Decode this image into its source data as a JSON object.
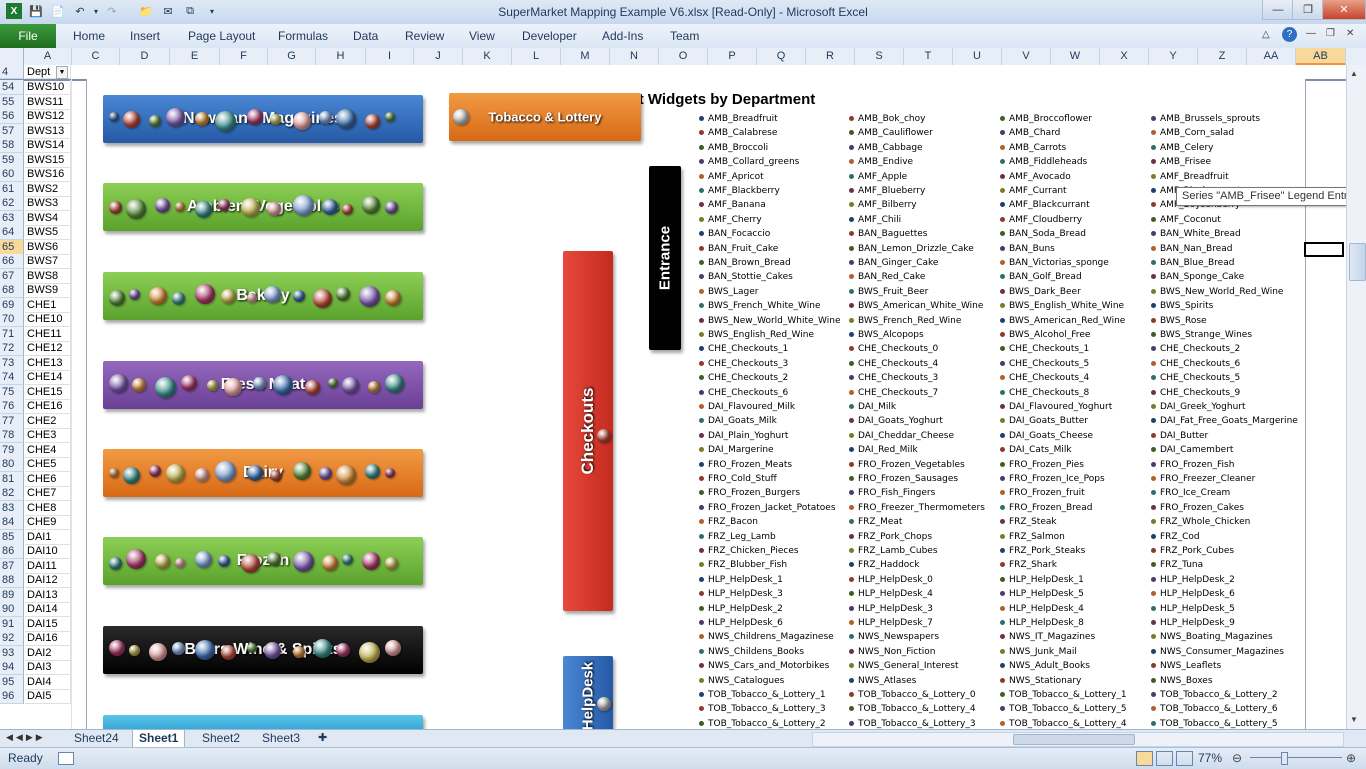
{
  "window": {
    "title": "SuperMarket Mapping Example V6.xlsx  [Read-Only]  -  Microsoft Excel"
  },
  "ribbon": {
    "file": "File",
    "tabs": [
      "Home",
      "Insert",
      "Page Layout",
      "Formulas",
      "Data",
      "Review",
      "View",
      "Developer",
      "Add-Ins",
      "Team"
    ]
  },
  "columns": [
    "A",
    "C",
    "D",
    "E",
    "F",
    "G",
    "H",
    "I",
    "J",
    "K",
    "L",
    "M",
    "N",
    "O",
    "P",
    "Q",
    "R",
    "S",
    "T",
    "U",
    "V",
    "W",
    "X",
    "Y",
    "Z",
    "AA",
    "AB"
  ],
  "header_row": {
    "num": "4",
    "dept": "Dept"
  },
  "rows": [
    {
      "n": "54",
      "d": "BWS10"
    },
    {
      "n": "55",
      "d": "BWS11"
    },
    {
      "n": "56",
      "d": "BWS12"
    },
    {
      "n": "57",
      "d": "BWS13"
    },
    {
      "n": "58",
      "d": "BWS14"
    },
    {
      "n": "59",
      "d": "BWS15"
    },
    {
      "n": "60",
      "d": "BWS16"
    },
    {
      "n": "61",
      "d": "BWS2"
    },
    {
      "n": "62",
      "d": "BWS3"
    },
    {
      "n": "63",
      "d": "BWS4"
    },
    {
      "n": "64",
      "d": "BWS5"
    },
    {
      "n": "65",
      "d": "BWS6"
    },
    {
      "n": "66",
      "d": "BWS7"
    },
    {
      "n": "67",
      "d": "BWS8"
    },
    {
      "n": "68",
      "d": "BWS9"
    },
    {
      "n": "69",
      "d": "CHE1"
    },
    {
      "n": "70",
      "d": "CHE10"
    },
    {
      "n": "71",
      "d": "CHE11"
    },
    {
      "n": "72",
      "d": "CHE12"
    },
    {
      "n": "73",
      "d": "CHE13"
    },
    {
      "n": "74",
      "d": "CHE14"
    },
    {
      "n": "75",
      "d": "CHE15"
    },
    {
      "n": "76",
      "d": "CHE16"
    },
    {
      "n": "77",
      "d": "CHE2"
    },
    {
      "n": "78",
      "d": "CHE3"
    },
    {
      "n": "79",
      "d": "CHE4"
    },
    {
      "n": "80",
      "d": "CHE5"
    },
    {
      "n": "81",
      "d": "CHE6"
    },
    {
      "n": "82",
      "d": "CHE7"
    },
    {
      "n": "83",
      "d": "CHE8"
    },
    {
      "n": "84",
      "d": "CHE9"
    },
    {
      "n": "85",
      "d": "DAI1"
    },
    {
      "n": "86",
      "d": "DAI10"
    },
    {
      "n": "87",
      "d": "DAI11"
    },
    {
      "n": "88",
      "d": "DAI12"
    },
    {
      "n": "89",
      "d": "DAI13"
    },
    {
      "n": "90",
      "d": "DAI14"
    },
    {
      "n": "91",
      "d": "DAI15"
    },
    {
      "n": "92",
      "d": "DAI16"
    },
    {
      "n": "93",
      "d": "DAI2"
    },
    {
      "n": "94",
      "d": "DAI3"
    },
    {
      "n": "95",
      "d": "DAI4"
    },
    {
      "n": "96",
      "d": "DAI5"
    }
  ],
  "chart": {
    "title": "Supermarket Widgets by Department",
    "widgets": {
      "newsstand": "News and Magazines",
      "tobacco": "Tobacco & Lottery",
      "ambient": "Ambient Vegetables",
      "bakery": "Bakery",
      "meat": "Fresh Meat",
      "dairy": "Dairy",
      "frozen": "Frozen",
      "bws": "Beers Wine & Spirits",
      "entrance": "Entrance",
      "checkouts": "Checkouts",
      "helpdesk": "HelpDesk"
    },
    "legend": [
      [
        "AMB_Breadfruit",
        "AMB_Bok_choy",
        "AMB_Broccoflower",
        "AMB_Brussels_sprouts"
      ],
      [
        "AMB_Calabrese",
        "AMB_Cauliflower",
        "AMB_Chard",
        "AMB_Corn_salad"
      ],
      [
        "AMB_Broccoli",
        "AMB_Cabbage",
        "AMB_Carrots",
        "AMB_Celery"
      ],
      [
        "AMB_Collard_greens",
        "AMB_Endive",
        "AMB_Fiddleheads",
        "AMB_Frisee"
      ],
      [
        "AMF_Apricot",
        "AMF_Apple",
        "AMF_Avocado",
        "AMF_Breadfruit"
      ],
      [
        "AMF_Blackberry",
        "AMF_Blueberry",
        "AMF_Currant",
        "AMF_Blackcurrant"
      ],
      [
        "AMF_Banana",
        "AMF_Bilberry",
        "AMF_Blackcurrant",
        "AMF_Boysenberry"
      ],
      [
        "AMF_Cherry",
        "AMF_Chili",
        "AMF_Cloudberry",
        "AMF_Coconut"
      ],
      [
        "BAN_Focaccio",
        "BAN_Baguettes",
        "BAN_Soda_Bread",
        "BAN_White_Bread"
      ],
      [
        "BAN_Fruit_Cake",
        "BAN_Lemon_Drizzle_Cake",
        "BAN_Buns",
        "BAN_Nan_Bread"
      ],
      [
        "BAN_Brown_Bread",
        "BAN_Ginger_Cake",
        "BAN_Victorias_sponge",
        "BAN_Blue_Bread"
      ],
      [
        "BAN_Stottie_Cakes",
        "BAN_Red_Cake",
        "BAN_Golf_Bread",
        "BAN_Sponge_Cake"
      ],
      [
        "BWS_Lager",
        "BWS_Fruit_Beer",
        "BWS_Dark_Beer",
        "BWS_New_World_Red_Wine"
      ],
      [
        "BWS_French_White_Wine",
        "BWS_American_White_Wine",
        "BWS_English_White_Wine",
        "BWS_Spirits"
      ],
      [
        "BWS_New_World_White_Wine",
        "BWS_French_Red_Wine",
        "BWS_American_Red_Wine",
        "BWS_Rose"
      ],
      [
        "BWS_English_Red_Wine",
        "BWS_Alcopops",
        "BWS_Alcohol_Free",
        "BWS_Strange_Wines"
      ],
      [
        "CHE_Checkouts_1",
        "CHE_Checkouts_0",
        "CHE_Checkouts_1",
        "CHE_Checkouts_2"
      ],
      [
        "CHE_Checkouts_3",
        "CHE_Checkouts_4",
        "CHE_Checkouts_5",
        "CHE_Checkouts_6"
      ],
      [
        "CHE_Checkouts_2",
        "CHE_Checkouts_3",
        "CHE_Checkouts_4",
        "CHE_Checkouts_5"
      ],
      [
        "CHE_Checkouts_6",
        "CHE_Checkouts_7",
        "CHE_Checkouts_8",
        "CHE_Checkouts_9"
      ],
      [
        "DAI_Flavoured_Milk",
        "DAI_Milk",
        "DAI_Flavoured_Yoghurt",
        "DAI_Greek_Yoghurt"
      ],
      [
        "DAI_Goats_Milk",
        "DAI_Goats_Yoghurt",
        "DAI_Goats_Butter",
        "DAI_Fat_Free_Goats_Margerine"
      ],
      [
        "DAI_Plain_Yoghurt",
        "DAI_Cheddar_Cheese",
        "DAI_Goats_Cheese",
        "DAI_Butter"
      ],
      [
        "DAI_Margerine",
        "DAI_Red_Milk",
        "DAI_Cats_Milk",
        "DAI_Camembert"
      ],
      [
        "FRO_Frozen_Meats",
        "FRO_Frozen_Vegetables",
        "FRO_Frozen_Pies",
        "FRO_Frozen_Fish"
      ],
      [
        "FRO_Cold_Stuff",
        "FRO_Frozen_Sausages",
        "FRO_Frozen_Ice_Pops",
        "FRO_Freezer_Cleaner"
      ],
      [
        "FRO_Frozen_Burgers",
        "FRO_Fish_Fingers",
        "FRO_Frozen_fruit",
        "FRO_Ice_Cream"
      ],
      [
        "FRO_Frozen_Jacket_Potatoes",
        "FRO_Freezer_Thermometers",
        "FRO_Frozen_Bread",
        "FRO_Frozen_Cakes"
      ],
      [
        "FRZ_Bacon",
        "FRZ_Meat",
        "FRZ_Steak",
        "FRZ_Whole_Chicken"
      ],
      [
        "FRZ_Leg_Lamb",
        "FRZ_Pork_Chops",
        "FRZ_Salmon",
        "FRZ_Cod"
      ],
      [
        "FRZ_Chicken_Pieces",
        "FRZ_Lamb_Cubes",
        "FRZ_Pork_Steaks",
        "FRZ_Pork_Cubes"
      ],
      [
        "FRZ_Blubber_Fish",
        "FRZ_Haddock",
        "FRZ_Shark",
        "FRZ_Tuna"
      ],
      [
        "HLP_HelpDesk_1",
        "HLP_HelpDesk_0",
        "HLP_HelpDesk_1",
        "HLP_HelpDesk_2"
      ],
      [
        "HLP_HelpDesk_3",
        "HLP_HelpDesk_4",
        "HLP_HelpDesk_5",
        "HLP_HelpDesk_6"
      ],
      [
        "HLP_HelpDesk_2",
        "HLP_HelpDesk_3",
        "HLP_HelpDesk_4",
        "HLP_HelpDesk_5"
      ],
      [
        "HLP_HelpDesk_6",
        "HLP_HelpDesk_7",
        "HLP_HelpDesk_8",
        "HLP_HelpDesk_9"
      ],
      [
        "NWS_Childrens_Magazinese",
        "NWS_Newspapers",
        "NWS_IT_Magazines",
        "NWS_Boating_Magazines"
      ],
      [
        "NWS_Childens_Books",
        "NWS_Non_Fiction",
        "NWS_Junk_Mail",
        "NWS_Consumer_Magazines"
      ],
      [
        "NWS_Cars_and_Motorbikes",
        "NWS_General_Interest",
        "NWS_Adult_Books",
        "NWS_Leaflets"
      ],
      [
        "NWS_Catalogues",
        "NWS_Atlases",
        "NWS_Stationary",
        "NWS_Boxes"
      ],
      [
        "TOB_Tobacco_&_Lottery_1",
        "TOB_Tobacco_&_Lottery_0",
        "TOB_Tobacco_&_Lottery_1",
        "TOB_Tobacco_&_Lottery_2"
      ],
      [
        "TOB_Tobacco_&_Lottery_3",
        "TOB_Tobacco_&_Lottery_4",
        "TOB_Tobacco_&_Lottery_5",
        "TOB_Tobacco_&_Lottery_6"
      ],
      [
        "TOB_Tobacco_&_Lottery_2",
        "TOB_Tobacco_&_Lottery_3",
        "TOB_Tobacco_&_Lottery_4",
        "TOB_Tobacco_&_Lottery_5"
      ]
    ],
    "tooltip": "Series \"AMB_Frisee\" Legend Entry"
  },
  "sheets": [
    "Sheet24",
    "Sheet1",
    "Sheet2",
    "Sheet3"
  ],
  "active_sheet": "Sheet1",
  "status": {
    "ready": "Ready",
    "zoom": "77%"
  },
  "colors": {
    "newsstand": "#2f6fc0",
    "tobacco": "#e07a1f",
    "ambient": "#6fb23a",
    "bakery": "#6fb23a",
    "meat": "#7c4fa6",
    "dairy": "#e07a1f",
    "frozen": "#6fb23a",
    "bws": "#111111",
    "entrance": "#000000",
    "checkouts": "#d9352a",
    "helpdesk": "#2f6fc0",
    "selection": "#f9d99b"
  }
}
